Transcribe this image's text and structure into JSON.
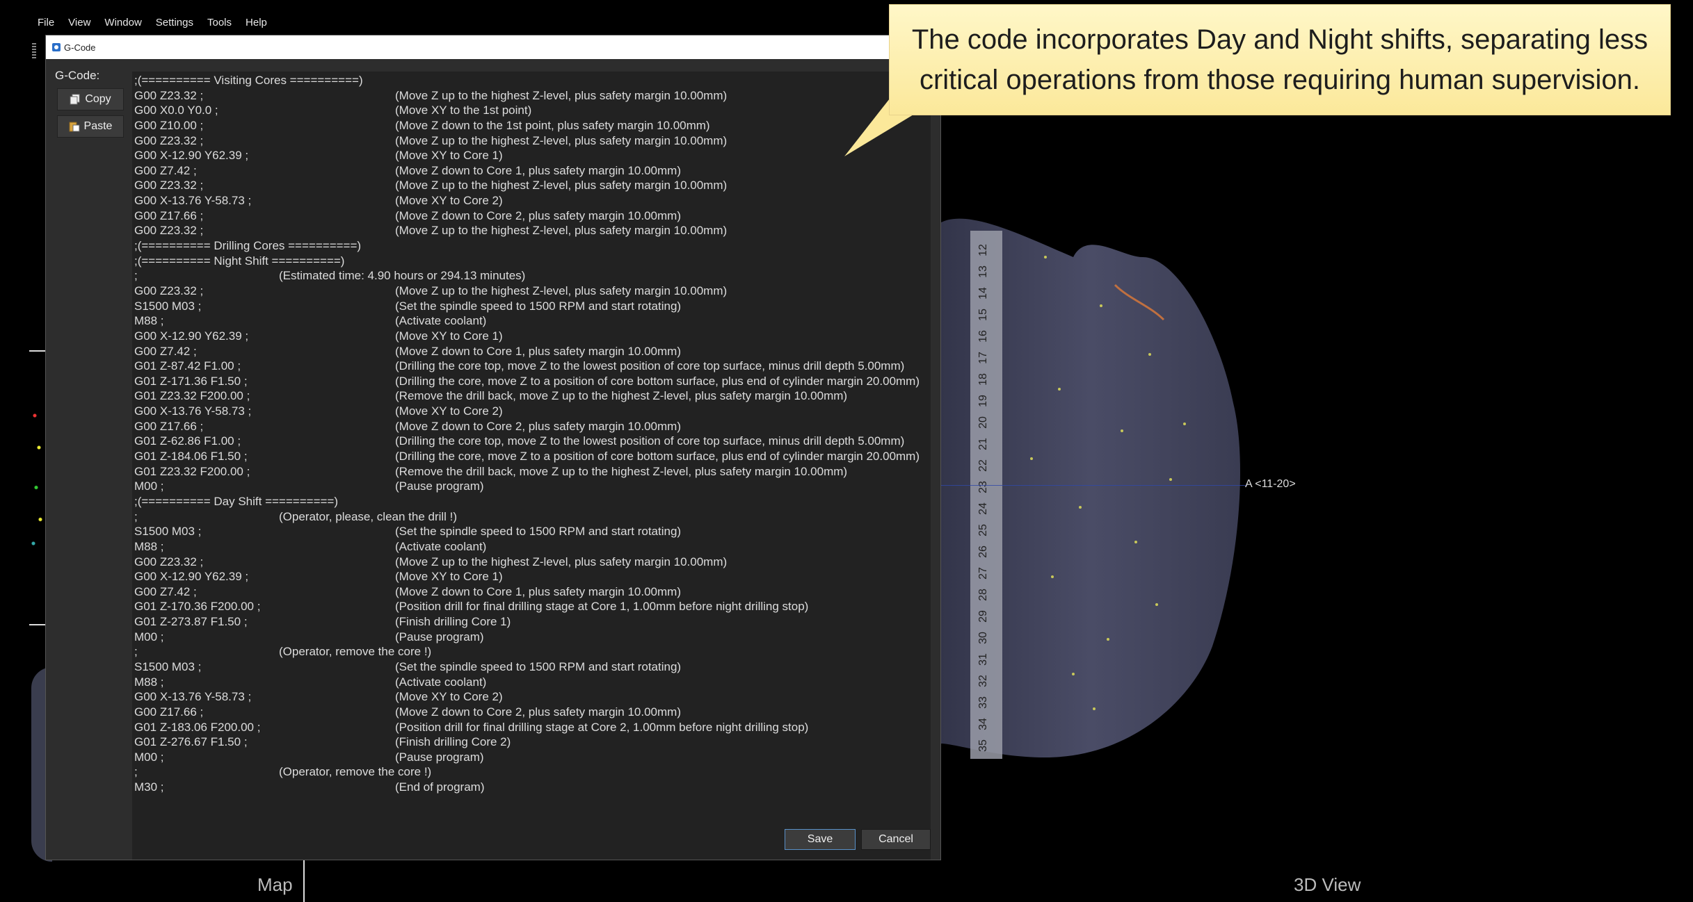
{
  "menu": [
    "File",
    "View",
    "Window",
    "Settings",
    "Tools",
    "Help"
  ],
  "dialog": {
    "title": "G-Code",
    "gcode_label": "G-Code:",
    "copy_label": "Copy",
    "paste_label": "Paste",
    "save_label": "Save",
    "cancel_label": "Cancel"
  },
  "gcode_lines": [
    {
      "code": ";(========== Visiting Cores ==========)",
      "est": "",
      "comment": ""
    },
    {
      "code": "G00 Z23.32 ;",
      "est": "",
      "comment": "(Move Z up to the highest Z-level, plus safety margin 10.00mm)"
    },
    {
      "code": "G00 X0.0 Y0.0 ;",
      "est": "",
      "comment": "(Move XY to the 1st point)"
    },
    {
      "code": "G00 Z10.00 ;",
      "est": "",
      "comment": "(Move Z down to the 1st point, plus safety margin 10.00mm)"
    },
    {
      "code": "G00 Z23.32 ;",
      "est": "",
      "comment": "(Move Z up to the highest Z-level, plus safety margin 10.00mm)"
    },
    {
      "code": "G00 X-12.90 Y62.39 ;",
      "est": "",
      "comment": "(Move XY to Core 1)"
    },
    {
      "code": "G00 Z7.42 ;",
      "est": "",
      "comment": "(Move Z down to Core 1, plus safety margin 10.00mm)"
    },
    {
      "code": "G00 Z23.32 ;",
      "est": "",
      "comment": "(Move Z up to the highest Z-level, plus safety margin 10.00mm)"
    },
    {
      "code": "G00 X-13.76 Y-58.73 ;",
      "est": "",
      "comment": "(Move XY to Core 2)"
    },
    {
      "code": "G00 Z17.66 ;",
      "est": "",
      "comment": "(Move Z down to Core 2, plus safety margin 10.00mm)"
    },
    {
      "code": "G00 Z23.32 ;",
      "est": "",
      "comment": "(Move Z up to the highest Z-level, plus safety margin 10.00mm)"
    },
    {
      "code": ";(========== Drilling Cores ==========)",
      "est": "",
      "comment": ""
    },
    {
      "code": ";(========== Night Shift ==========)",
      "est": "",
      "comment": ""
    },
    {
      "code": ";",
      "est": "(Estimated time: 4.90 hours or 294.13 minutes)",
      "comment": ""
    },
    {
      "code": "G00 Z23.32 ;",
      "est": "",
      "comment": "(Move Z up to the highest Z-level, plus safety margin 10.00mm)"
    },
    {
      "code": "S1500 M03 ;",
      "est": "",
      "comment": "(Set the spindle speed to 1500 RPM and start rotating)"
    },
    {
      "code": "M88 ;",
      "est": "",
      "comment": "(Activate coolant)"
    },
    {
      "code": "G00 X-12.90 Y62.39 ;",
      "est": "",
      "comment": "(Move XY to Core 1)"
    },
    {
      "code": "G00 Z7.42 ;",
      "est": "",
      "comment": "(Move Z down to Core 1, plus safety margin 10.00mm)"
    },
    {
      "code": "G01 Z-87.42 F1.00 ;",
      "est": "",
      "comment": "(Drilling the core top, move Z to the lowest position of core top surface, minus drill depth 5.00mm)"
    },
    {
      "code": "G01 Z-171.36 F1.50 ;",
      "est": "",
      "comment": "(Drilling the core, move Z to a position of core bottom surface, plus end of cylinder margin 20.00mm)"
    },
    {
      "code": "G01 Z23.32 F200.00 ;",
      "est": "",
      "comment": "(Remove the drill back, move Z up to the highest Z-level, plus safety margin 10.00mm)"
    },
    {
      "code": "G00 X-13.76 Y-58.73 ;",
      "est": "",
      "comment": "(Move XY to Core 2)"
    },
    {
      "code": "G00 Z17.66 ;",
      "est": "",
      "comment": "(Move Z down to Core 2, plus safety margin 10.00mm)"
    },
    {
      "code": "G01 Z-62.86 F1.00 ;",
      "est": "",
      "comment": "(Drilling the core top, move Z to the lowest position of core top surface, minus drill depth 5.00mm)"
    },
    {
      "code": "G01 Z-184.06 F1.50 ;",
      "est": "",
      "comment": "(Drilling the core, move Z to a position of core bottom surface, plus end of cylinder margin 20.00mm)"
    },
    {
      "code": "G01 Z23.32 F200.00 ;",
      "est": "",
      "comment": "(Remove the drill back, move Z up to the highest Z-level, plus safety margin 10.00mm)"
    },
    {
      "code": "M00 ;",
      "est": "",
      "comment": "(Pause program)"
    },
    {
      "code": ";(========== Day Shift ==========)",
      "est": "",
      "comment": ""
    },
    {
      "code": ";",
      "est": "(Operator, please, clean the drill !)",
      "comment": ""
    },
    {
      "code": "S1500 M03 ;",
      "est": "",
      "comment": "(Set the spindle speed to 1500 RPM and start rotating)"
    },
    {
      "code": "M88 ;",
      "est": "",
      "comment": "(Activate coolant)"
    },
    {
      "code": "G00 Z23.32 ;",
      "est": "",
      "comment": "(Move Z up to the highest Z-level, plus safety margin 10.00mm)"
    },
    {
      "code": "G00 X-12.90 Y62.39 ;",
      "est": "",
      "comment": "(Move XY to Core 1)"
    },
    {
      "code": "G00 Z7.42 ;",
      "est": "",
      "comment": "(Move Z down to Core 1, plus safety margin 10.00mm)"
    },
    {
      "code": "G01 Z-170.36 F200.00 ;",
      "est": "",
      "comment": "(Position drill for final drilling stage at Core 1, 1.00mm before night drilling stop)"
    },
    {
      "code": "G01 Z-273.87 F1.50 ;",
      "est": "",
      "comment": "(Finish drilling Core 1)"
    },
    {
      "code": "M00 ;",
      "est": "",
      "comment": "(Pause program)"
    },
    {
      "code": ";",
      "est": "(Operator, remove the core !)",
      "comment": ""
    },
    {
      "code": "S1500 M03 ;",
      "est": "",
      "comment": "(Set the spindle speed to 1500 RPM and start rotating)"
    },
    {
      "code": "M88 ;",
      "est": "",
      "comment": "(Activate coolant)"
    },
    {
      "code": "G00 X-13.76 Y-58.73 ;",
      "est": "",
      "comment": "(Move XY to Core 2)"
    },
    {
      "code": "G00 Z17.66 ;",
      "est": "",
      "comment": "(Move Z down to Core 2, plus safety margin 10.00mm)"
    },
    {
      "code": "G01 Z-183.06 F200.00 ;",
      "est": "",
      "comment": "(Position drill for final drilling stage at Core 2, 1.00mm before night drilling stop)"
    },
    {
      "code": "G01 Z-276.67 F1.50 ;",
      "est": "",
      "comment": "(Finish drilling Core 2)"
    },
    {
      "code": "M00 ;",
      "est": "",
      "comment": "(Pause program)"
    },
    {
      "code": ";",
      "est": "(Operator, remove the core !)",
      "comment": ""
    },
    {
      "code": "M30 ;",
      "est": "",
      "comment": "(End of program)"
    }
  ],
  "callout": {
    "text": "The code incorporates Day and Night shifts, separating less critical operations from those requiring human supervision."
  },
  "view3d": {
    "coord_label": "A <11-20>",
    "ruler_numbers": [
      "12",
      "13",
      "14",
      "15",
      "16",
      "17",
      "18",
      "19",
      "20",
      "21",
      "22",
      "23",
      "24",
      "25",
      "26",
      "27",
      "28",
      "29",
      "30",
      "31",
      "32",
      "33",
      "34",
      "35"
    ]
  },
  "bottom": {
    "map_label": "Map",
    "view_label": "3D View"
  },
  "colors": {
    "callout_bg": "#fbe89a",
    "save_border": "#5a90c8",
    "editor_bg": "#222222"
  }
}
